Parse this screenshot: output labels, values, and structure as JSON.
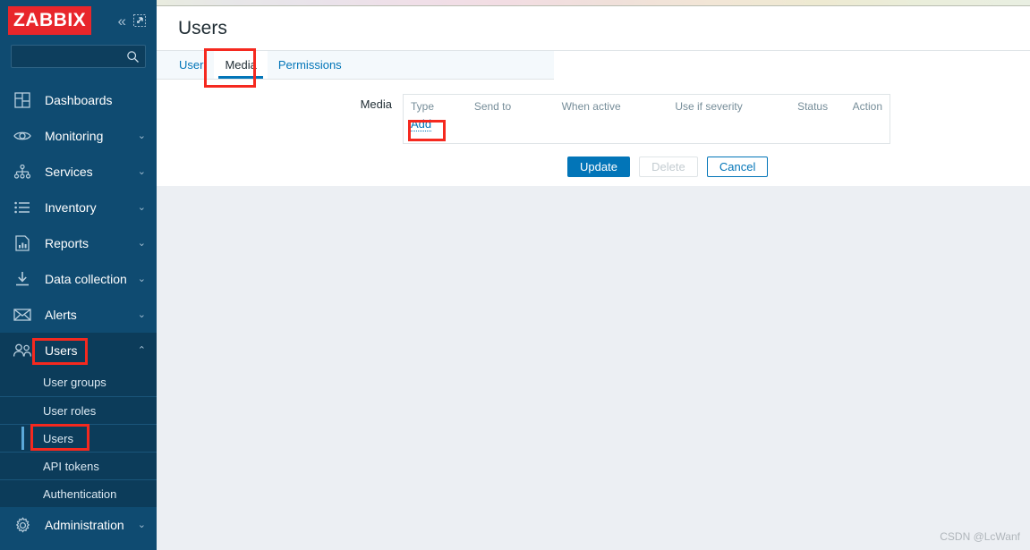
{
  "brand": {
    "logo_text": "ZABBIX",
    "logo_bg": "#e8262b",
    "sidebar_bg": "#0f4b71",
    "accent": "#0275b8",
    "annotation_color": "#f5291f"
  },
  "sidebar": {
    "collapse_icon": "chevron-double-left-icon",
    "kiosk_icon": "kiosk-expand-icon",
    "search": {
      "value": "",
      "placeholder": "",
      "icon": "search-icon"
    },
    "items": [
      {
        "label": "Dashboards",
        "icon": "dashboard-grid-icon",
        "arrow": "",
        "active": false
      },
      {
        "label": "Monitoring",
        "icon": "eye-icon",
        "arrow": "⌄",
        "active": false
      },
      {
        "label": "Services",
        "icon": "sitemap-icon",
        "arrow": "⌄",
        "active": false
      },
      {
        "label": "Inventory",
        "icon": "list-icon",
        "arrow": "⌄",
        "active": false
      },
      {
        "label": "Reports",
        "icon": "report-chart-icon",
        "arrow": "⌄",
        "active": false
      },
      {
        "label": "Data collection",
        "icon": "download-icon",
        "arrow": "⌄",
        "active": false
      },
      {
        "label": "Alerts",
        "icon": "envelope-icon",
        "arrow": "⌄",
        "active": false
      },
      {
        "label": "Users",
        "icon": "users-icon",
        "arrow": "⌃",
        "active": true
      }
    ],
    "submenu": [
      {
        "label": "User groups",
        "selected": false
      },
      {
        "label": "User roles",
        "selected": false
      },
      {
        "label": "Users",
        "selected": true
      },
      {
        "label": "API tokens",
        "selected": false
      },
      {
        "label": "Authentication",
        "selected": false
      }
    ],
    "footer_item": {
      "label": "Administration",
      "icon": "gear-icon",
      "arrow": "⌄"
    }
  },
  "header": {
    "title": "Users"
  },
  "tabs": [
    {
      "label": "User",
      "active": false
    },
    {
      "label": "Media",
      "active": true
    },
    {
      "label": "Permissions",
      "active": false
    }
  ],
  "form": {
    "media_field_label": "Media",
    "table": {
      "columns": [
        "Type",
        "Send to",
        "When active",
        "Use if severity",
        "Status",
        "Action"
      ],
      "rows": [],
      "add_label": "Add"
    },
    "buttons": [
      {
        "label": "Update",
        "style": "primary",
        "disabled": false
      },
      {
        "label": "Delete",
        "style": "disabled",
        "disabled": true
      },
      {
        "label": "Cancel",
        "style": "secondary",
        "disabled": false
      }
    ]
  },
  "watermark": "CSDN @LcWanf"
}
